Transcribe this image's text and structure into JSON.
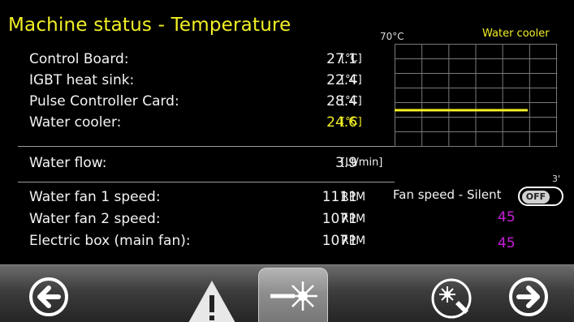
{
  "title": "Machine status - Temperature",
  "temperatures": [
    {
      "label": "Control Board:",
      "value": "27.1",
      "unit": "[°C]"
    },
    {
      "label": "IGBT heat sink:",
      "value": "22.4",
      "unit": "[°C]"
    },
    {
      "label": "Pulse Controller Card:",
      "value": "28.4",
      "unit": "[°C]"
    },
    {
      "label": "Water cooler:",
      "value": "24.6",
      "unit": "[°C]"
    }
  ],
  "flow": {
    "label": "Water flow:",
    "value": "3.9",
    "unit": "[Lt/min]"
  },
  "fans": [
    {
      "label": "Water fan 1 speed:",
      "value": "1111",
      "unit": "RPM"
    },
    {
      "label": "Water fan 2 speed:",
      "value": "1071",
      "unit": "RPM"
    },
    {
      "label": "Electric box (main fan):",
      "value": "1071",
      "unit": "RPM"
    }
  ],
  "chart": {
    "top_label": "70°C",
    "series_label": "Water cooler",
    "line_color": "#f2ef24",
    "grid_color": "#7a7a7a",
    "level_fraction": 0.57
  },
  "fan_speed": {
    "label": "Fan speed - Silent",
    "toggle_text": "OFF",
    "scale_tick": "3'",
    "values": [
      "45",
      "45"
    ]
  },
  "colors": {
    "accent": "#f2ef24",
    "magenta": "#c71ed9"
  },
  "toolbar": {
    "icons": [
      "arrow-left-circle-icon",
      "warning-triangle-icon",
      "laser-beam-icon",
      "laser-pointer-icon",
      "arrow-right-circle-icon"
    ]
  }
}
